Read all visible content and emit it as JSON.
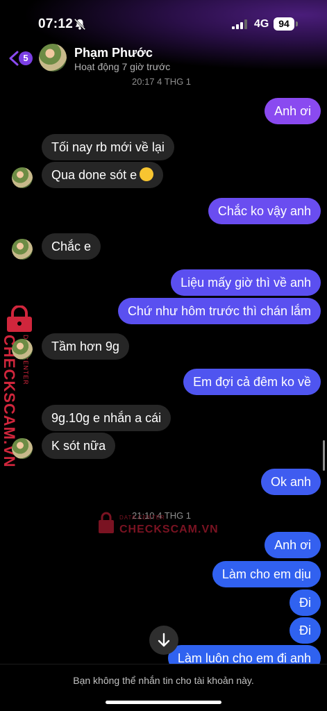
{
  "status_bar": {
    "time": "07:12",
    "network": "4G",
    "battery": "94"
  },
  "header": {
    "back_badge": "5",
    "contact_name": "Phạm Phước",
    "contact_status": "Hoạt động 7 giờ trước"
  },
  "timestamps": [
    "20:17 4 THG 1",
    "21:10 4 THG 1"
  ],
  "messages": [
    {
      "side": "out",
      "text": "Anh ơi"
    },
    {
      "side": "in",
      "text": "Tối nay rb mới về lại"
    },
    {
      "side": "in",
      "text": "Qua done sót e"
    },
    {
      "side": "out",
      "text": "Chắc ko vậy anh"
    },
    {
      "side": "in",
      "text": "Chắc e"
    },
    {
      "side": "out",
      "text": "Liệu mấy giờ thì về anh"
    },
    {
      "side": "out",
      "text": "Chứ như hôm trước thì chán lắm"
    },
    {
      "side": "in",
      "text": "Tầm hơn 9g"
    },
    {
      "side": "out",
      "text": "Em đợi cả đêm ko về"
    },
    {
      "side": "in",
      "text": "9g.10g e nhắn a cái"
    },
    {
      "side": "in",
      "text": "K sót nữa"
    },
    {
      "side": "out",
      "text": "Ok anh"
    },
    {
      "side": "out",
      "text": "Anh ơi"
    },
    {
      "side": "out",
      "text": "Làm cho em dịu"
    },
    {
      "side": "out",
      "text": "Đi"
    },
    {
      "side": "out",
      "text": "Đi"
    },
    {
      "side": "out",
      "text": "Làm luôn cho em đi anh"
    }
  ],
  "watermark": {
    "brand": "CHECKSCAM.VN",
    "tagline": "DATA CENTER"
  },
  "footer": {
    "notice": "Bạn không thể nhắn tin cho tài khoản này."
  },
  "colors": {
    "bubble_out_top": "#8a4af0",
    "bubble_out_bottom": "#2f62f0",
    "bubble_in": "#262626",
    "watermark": "#d0263c"
  },
  "icons": [
    "bell-slash-icon",
    "cellular-signal-icon",
    "back-chevron-icon",
    "arrow-down-icon",
    "lock-icon",
    "smile-emoji-icon"
  ]
}
